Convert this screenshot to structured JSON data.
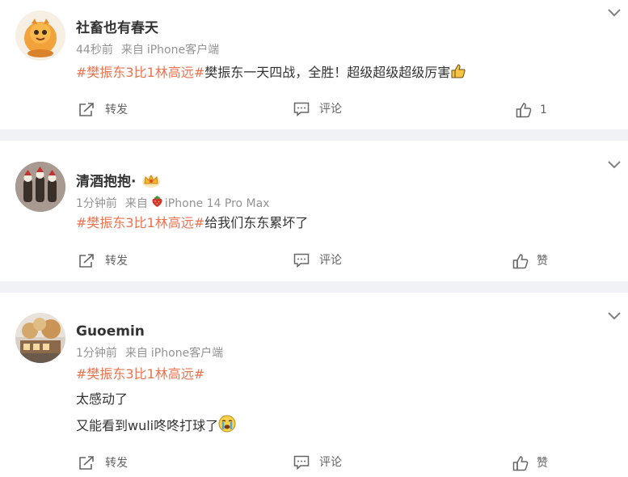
{
  "colors": {
    "topic": "#eb7350",
    "meta": "#939393",
    "text": "#333333",
    "divider": "#f1f2f5"
  },
  "actions": {
    "repost": "转发",
    "comment": "评论",
    "like": "赞"
  },
  "posts": [
    {
      "username": "社畜也有春天",
      "time": "44秒前",
      "source_prefix": "来自",
      "source": "iPhone客户端",
      "source_icon": "",
      "topic": "#樊振东3比1林高远#",
      "lines": [
        "樊振东一天四战，全胜！超级超级超级厉害"
      ],
      "line_emoji": "thumbs-up-emoji",
      "like_count": "1"
    },
    {
      "username": "清酒抱抱·",
      "badge": "crown-badge-icon",
      "time": "1分钟前",
      "source_prefix": "来自",
      "source_icon": "strawberry-icon",
      "source": "iPhone 14 Pro Max",
      "topic": "#樊振东3比1林高远#",
      "lines": [
        "给我们东东累坏了"
      ]
    },
    {
      "username": "Guoemin",
      "time": "1分钟前",
      "source_prefix": "来自",
      "source": "iPhone客户端",
      "topic": "#樊振东3比1林高远#",
      "lines": [
        "太感动了",
        "又能看到wuli咚咚打球了"
      ],
      "line_emoji": "crying-face-emoji"
    }
  ]
}
